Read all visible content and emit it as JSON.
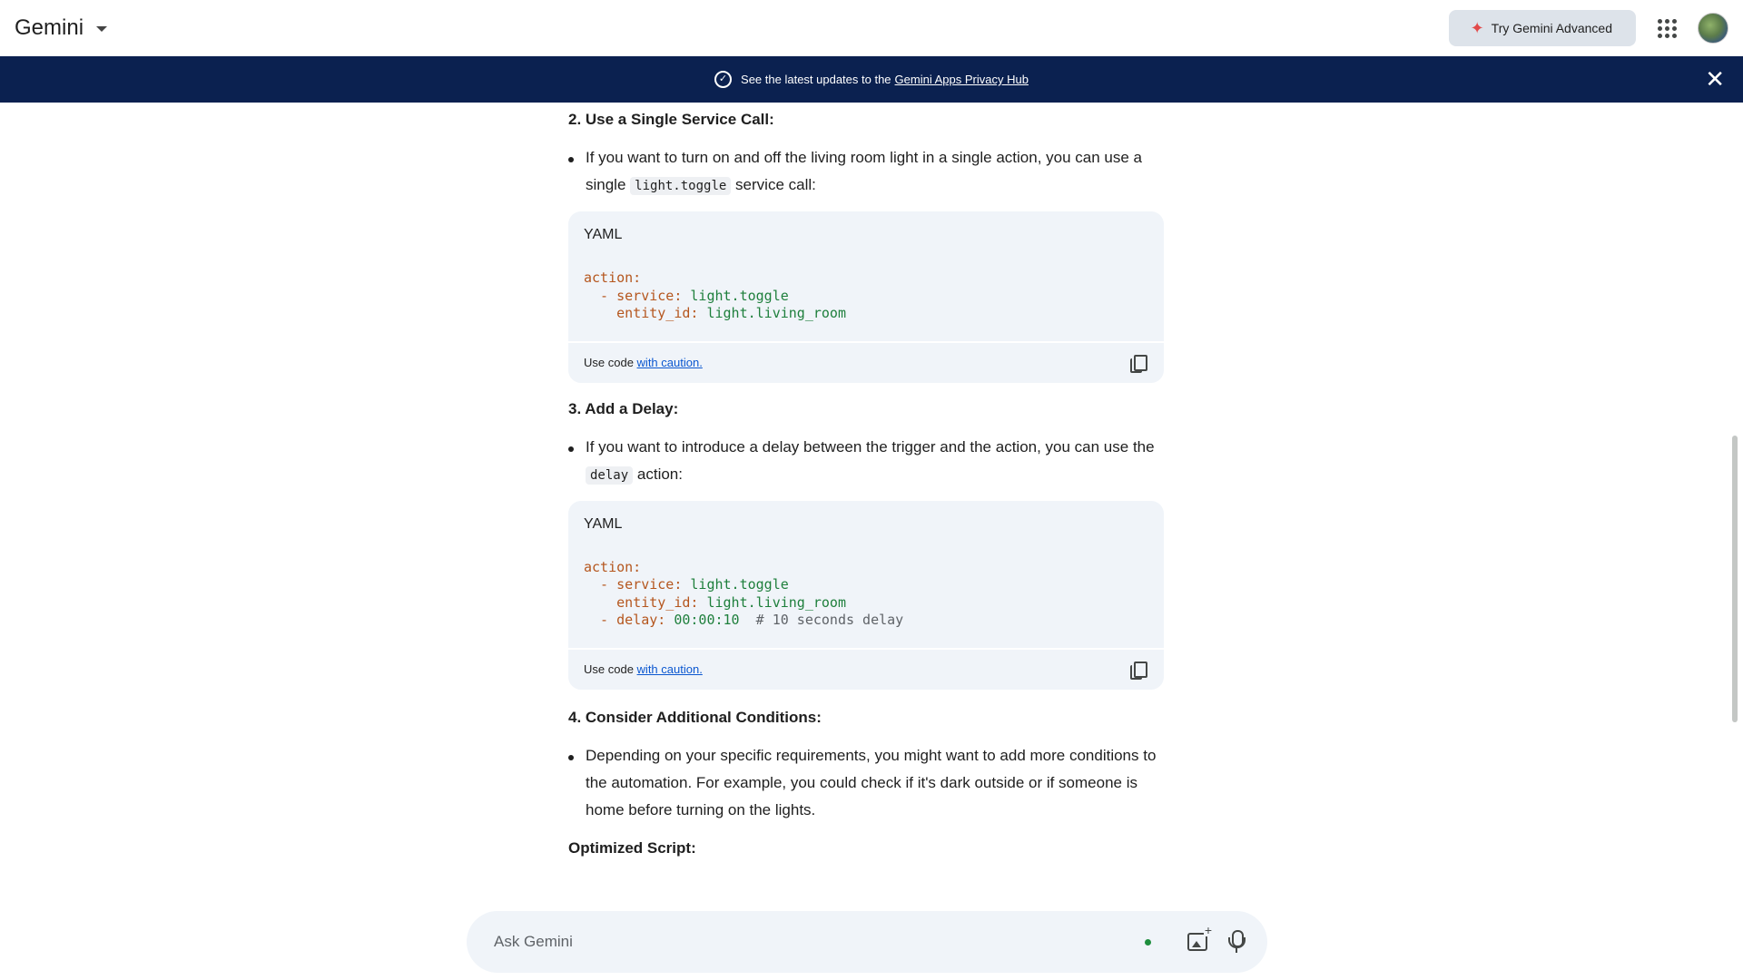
{
  "header": {
    "brand": "Gemini",
    "try_advanced": "Try Gemini Advanced"
  },
  "banner": {
    "text": "See the latest updates to the",
    "link": "Gemini Apps Privacy Hub"
  },
  "sections": {
    "s2": {
      "heading": "2. Use a Single Service Call:",
      "bullet_pre": "If you want to turn on and off the living room light in a single action, you can use a single",
      "bullet_code": "light.toggle",
      "bullet_post": "service call:"
    },
    "s3": {
      "heading": "3. Add a Delay:",
      "bullet_pre": "If you want to introduce a delay between the trigger and the action, you can use the",
      "bullet_code": "delay",
      "bullet_post": "action:"
    },
    "s4": {
      "heading": "4. Consider Additional Conditions:",
      "bullet": "Depending on your specific requirements, you might want to add more conditions to the automation. For example, you could check if it's dark outside or if someone is home before turning on the lights."
    },
    "optimized": "Optimized Script:"
  },
  "code1": {
    "lang": "YAML",
    "l1k": "action:",
    "l2k": "  - service:",
    "l2v": " light.toggle",
    "l3k": "    entity_id:",
    "l3v": " light.living_room"
  },
  "code2": {
    "lang": "YAML",
    "l1k": "action:",
    "l2k": "  - service:",
    "l2v": " light.toggle",
    "l3k": "    entity_id:",
    "l3v": " light.living_room",
    "l4k": "  - delay:",
    "l4v": " 00:00:10",
    "l4c": "  # 10 seconds delay"
  },
  "code_footer": {
    "prefix": "Use code",
    "link": "with caution."
  },
  "input": {
    "placeholder": "Ask Gemini"
  },
  "colors": {
    "banner_bg": "#0b2150",
    "code_bg": "#f0f4f9",
    "link": "#0b57d0"
  }
}
